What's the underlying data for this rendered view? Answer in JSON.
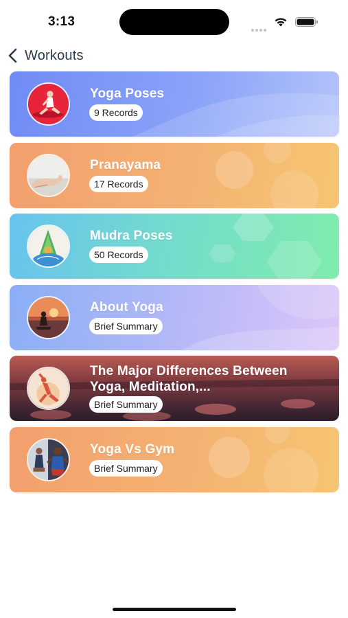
{
  "status": {
    "time": "3:13"
  },
  "nav": {
    "back_label": "Workouts"
  },
  "cards": [
    {
      "title": "Yoga Poses",
      "badge": "9 Records",
      "image": "yoga-pose-icon"
    },
    {
      "title": "Pranayama",
      "badge": "17 Records",
      "image": "meditating-hand-icon"
    },
    {
      "title": "Mudra Poses",
      "badge": "50 Records",
      "image": "mudra-hands-icon"
    },
    {
      "title": "About Yoga",
      "badge": "Brief Summary",
      "image": "sunset-yoga-icon"
    },
    {
      "title": "The Major Differences Between Yoga, Meditation,...",
      "badge": "Brief Summary",
      "image": "yoga-stretch-icon"
    },
    {
      "title": "Yoga Vs Gym",
      "badge": "Brief Summary",
      "image": "gym-vs-yoga-icon"
    }
  ],
  "colors": {
    "card_blue": "#7f96f7",
    "card_orange": "#f3a873",
    "card_green": "#7fe3b0",
    "card_lavender": "#c6b9f7",
    "card_sunset": "#7a2e34"
  }
}
